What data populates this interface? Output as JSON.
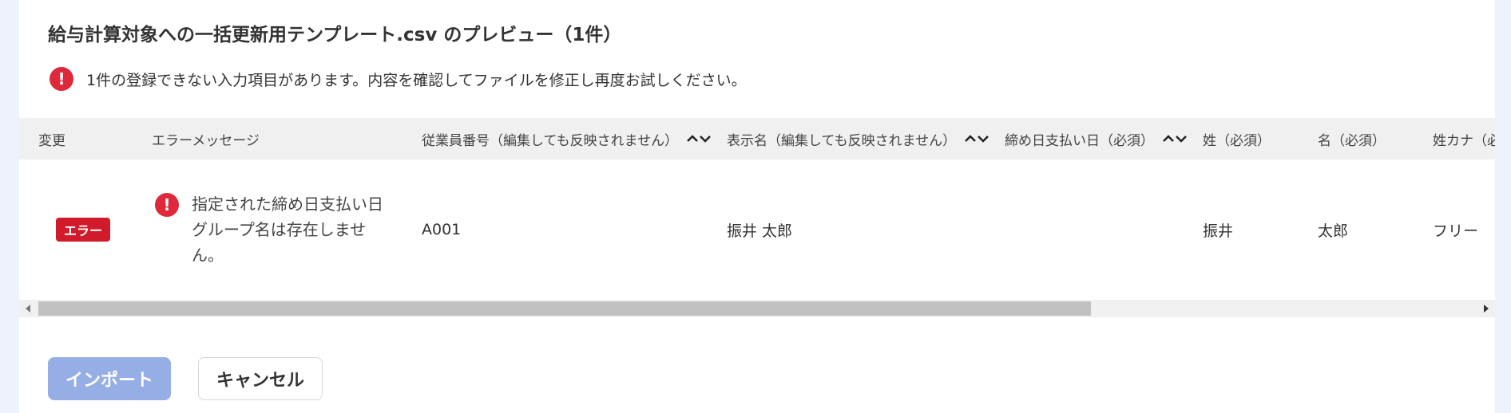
{
  "title": "給与計算対象への一括更新用テンプレート.csv のプレビュー（1件）",
  "alert": {
    "icon": "exclamation-icon",
    "message": "1件の登録できない入力項目があります。内容を確認してファイルを修正し再度お試しください。"
  },
  "table": {
    "columns": [
      {
        "label": "変更",
        "sortable": false
      },
      {
        "label": "エラーメッセージ",
        "sortable": false
      },
      {
        "label": "従業員番号（編集しても反映されません）",
        "sortable": true
      },
      {
        "label": "表示名（編集しても反映されません）",
        "sortable": true
      },
      {
        "label": "締め日支払い日（必須）",
        "sortable": true
      },
      {
        "label": "姓（必須）",
        "sortable": false
      },
      {
        "label": "名（必須）",
        "sortable": false
      },
      {
        "label": "姓カナ（必",
        "sortable": false
      }
    ],
    "rows": [
      {
        "status": "エラー",
        "error_message": "指定された締め日支払い日グループ名は存在しません。",
        "employee_no": "A001",
        "display_name": "振井 太郎",
        "closing_payday": "",
        "last_name": "振井",
        "first_name": "太郎",
        "last_name_kana": "フリー"
      }
    ]
  },
  "buttons": {
    "import_label": "インポート",
    "cancel_label": "キャンセル"
  },
  "colors": {
    "error_red": "#e0283c",
    "primary_disabled": "#96aee6",
    "header_bg": "#f0f0f0"
  }
}
